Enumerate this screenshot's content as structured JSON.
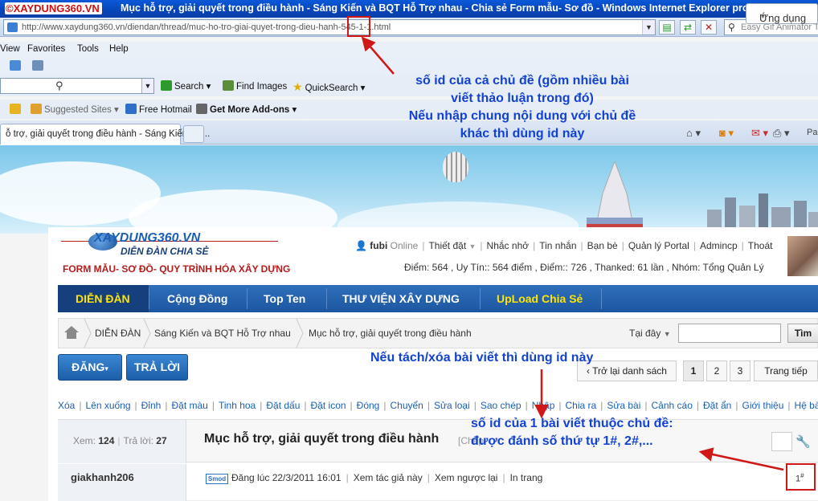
{
  "browser": {
    "window_title": "Mục hỗ trợ, giải quyết trong điều hành - Sáng Kiến và BQT Hỗ Trợ nhau - Chia sẻ Form mẫu- Sơ đồ - Windows Internet Explorer pro",
    "watermark_logo": "XAYDUNG360.VN",
    "url": "http://www.xaydung360.vn/diendan/thread/muc-ho-tro-giai-quyet-trong-dieu-hanh-545-1-1.html",
    "search_placeholder": "Easy Gif Animator T",
    "menu": [
      "View",
      "Favorites",
      "Tools",
      "Help"
    ],
    "toolbar": {
      "search_label": "Search",
      "find_images": "Find Images",
      "quick_search": "QuickSearch",
      "suggested_sites": "Suggested Sites",
      "free_hotmail": "Free Hotmail",
      "get_more_addons": "Get More Add-ons"
    },
    "tab_title": "ỗ trợ, giải quyết trong điều hành - Sáng Kiến và ...",
    "page_menu_partial": "Pa"
  },
  "forum": {
    "logo": "XAYDUNG360.VN",
    "logo_sub": "DIỄN ĐÀN CHIA SẺ",
    "slogan": "FORM MẪU- SƠ ĐỒ- QUY TRÌNH HÓA XÂY DỰNG",
    "user": {
      "name": "fubi",
      "status": "Online",
      "links": [
        "Thiết đặt",
        "Nhắc nhở",
        "Tin nhắn",
        "Bạn bè",
        "Quản lý Portal",
        "Admincp",
        "Thoát"
      ],
      "stats": "Điểm: 564 , Uy Tín:: 564 điểm , Điểm:: 726 , Thanked: 61 lần , Nhóm: Tổng Quản Lý"
    },
    "nav": {
      "items": [
        "DIỄN ĐÀN",
        "Cộng Đồng",
        "Top Ten",
        "THƯ VIỆN XÂY DỰNG",
        "UpLoad Chia Sẻ"
      ],
      "apps": "Ứng dụng"
    },
    "breadcrumb": [
      "DIỄN ĐÀN",
      "Sáng Kiến và BQT Hỗ Trợ nhau",
      "Mục hỗ trợ, giải quyết trong điều hành"
    ],
    "search_label": "Tại đây",
    "search_button": "Tìm",
    "buttons": {
      "post": "ĐĂNG",
      "reply": "TRẢ LỜI"
    },
    "pager": {
      "back": "Trở lại danh sách",
      "pages": [
        "1",
        "2",
        "3"
      ],
      "next": "Trang tiếp"
    },
    "mod_tools": [
      "Xóa",
      "Lên xuống",
      "Đỉnh",
      "Đặt màu",
      "Tinh hoa",
      "Đặt dấu",
      "Đặt icon",
      "Đóng",
      "Chuyển",
      "Sửa loại",
      "Sao chép",
      "Nhập",
      "Chia ra",
      "Sửa bài",
      "Cảnh cáo",
      "Đặt ẩn",
      "Giới thiệu",
      "Hệ bài"
    ],
    "thread": {
      "views_label": "Xem:",
      "views": "124",
      "replies_label": "Trả lời:",
      "replies": "27",
      "title": "Mục hỗ trợ, giải quyết trong điều hành",
      "copy_label": "[Chép"
    },
    "post": {
      "author": "giakhanh206",
      "badge": "Smod",
      "meta": [
        "Đăng lúc 22/3/2011 16:01",
        "Xem tác giả này",
        "Xem ngược lại",
        "In trang"
      ],
      "number": "1",
      "number_mark": "#"
    }
  },
  "annotations": {
    "thread_id_note": [
      "số id của cả chủ đề (gồm nhiều bài",
      "viết thảo luận trong đó)",
      "Nếu nhập chung nội dung với chủ đề",
      "khác thì dùng id này"
    ],
    "split_note": "Nếu tách/xóa bài viết thì dùng id này",
    "post_id_note": [
      "số id của 1 bài viết thuộc chủ đề:",
      "được đánh số thứ tự 1#, 2#,..."
    ]
  },
  "colors": {
    "annotation_text": "#1242d2",
    "annotation_red": "#d01818",
    "nav_blue": "#1d56a0",
    "slogan_red": "#b51c1c",
    "upload_yellow": "#ffe400"
  }
}
